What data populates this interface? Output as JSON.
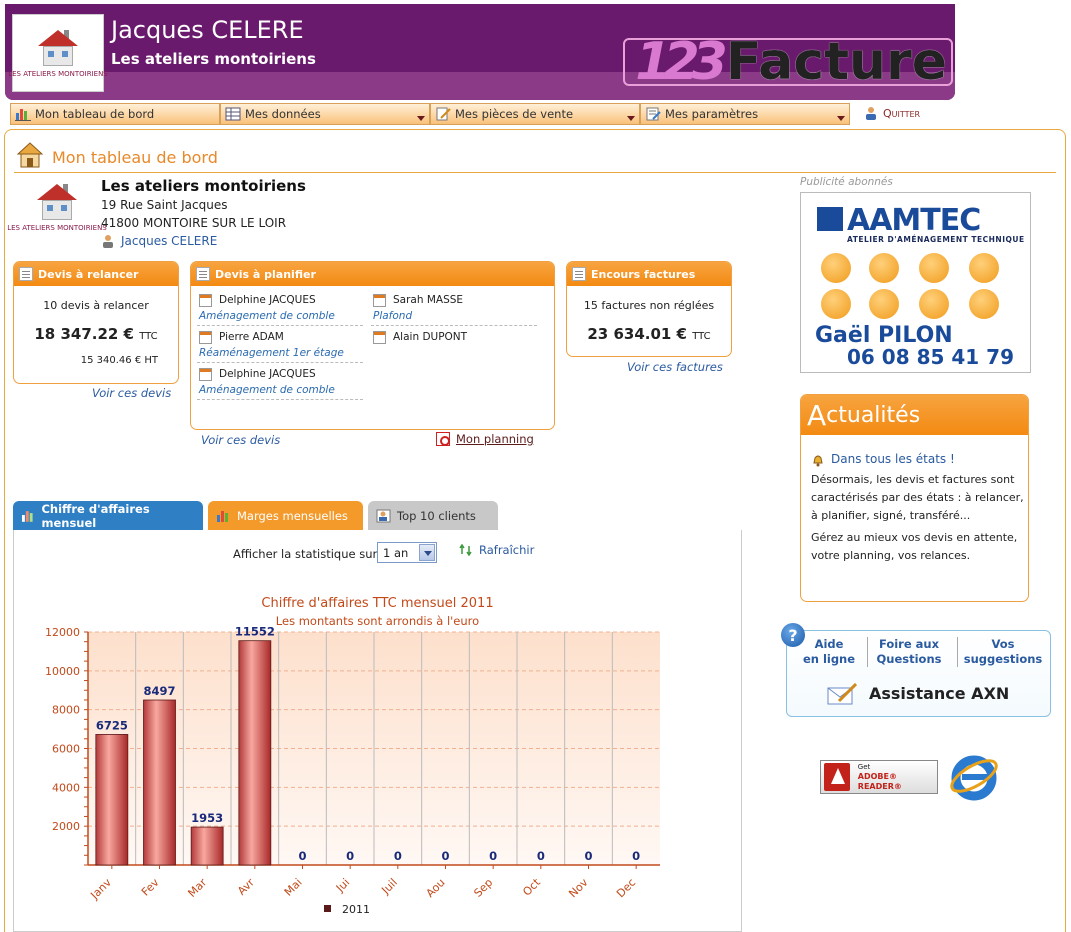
{
  "header": {
    "user_name": "Jacques CELERE",
    "company": "Les ateliers montoiriens",
    "logo_caption": "LES ATELIERS MONTOIRIENS",
    "brand_num": "123",
    "brand_word": "Facture"
  },
  "nav": {
    "items": [
      {
        "label": "Mon tableau de bord",
        "icon": "bar-chart-icon"
      },
      {
        "label": "Mes données",
        "icon": "table-icon"
      },
      {
        "label": "Mes pièces de vente",
        "icon": "document-edit-icon"
      },
      {
        "label": "Mes paramètres",
        "icon": "settings-list-icon"
      }
    ],
    "quit": "Quitter"
  },
  "page": {
    "title": "Mon tableau de bord"
  },
  "company": {
    "name": "Les ateliers montoiriens",
    "address1": "19 Rue Saint Jacques",
    "address2": "41800 MONTOIRE SUR LE LOIR",
    "user": "Jacques CELERE",
    "logo_caption": "LES ATELIERS MONTOIRIENS"
  },
  "devis_relancer": {
    "title": "Devis à relancer",
    "count_text": "10 devis à relancer",
    "amount": "18 347.22 €",
    "amount_unit": "TTC",
    "ht": "15 340.46 € HT",
    "link": "Voir ces devis"
  },
  "devis_planifier": {
    "title": "Devis à planifier",
    "items": [
      {
        "name": "Delphine JACQUES",
        "desc": "Aménagement de comble"
      },
      {
        "name": "Sarah MASSE",
        "desc": "Plafond"
      },
      {
        "name": "Pierre ADAM",
        "desc": "Réaménagement 1er étage"
      },
      {
        "name": "Alain DUPONT",
        "desc": ""
      },
      {
        "name": "Delphine JACQUES",
        "desc": "Aménagement de comble"
      }
    ],
    "link": "Voir ces devis",
    "planning": "Mon planning"
  },
  "encours": {
    "title": "Encours factures",
    "count_text": "15 factures non réglées",
    "amount": "23 634.01 €",
    "amount_unit": "TTC",
    "link": "Voir ces factures"
  },
  "tabs": [
    {
      "label": "Chiffre d'affaires mensuel",
      "color": "#2e7fc4"
    },
    {
      "label": "Marges mensuelles",
      "color": "#f39a2a"
    },
    {
      "label": "Top 10 clients",
      "color": "#bdbdbd"
    }
  ],
  "stat": {
    "label": "Afficher la statistique sur",
    "selected": "1 an",
    "refresh": "Rafraîchir"
  },
  "chart_data": {
    "type": "bar",
    "title": "Chiffre d'affaires TTC mensuel 2011",
    "subtitle": "Les montants sont arrondis à l'euro",
    "categories": [
      "Janv",
      "Fev",
      "Mar",
      "Avr",
      "Mai",
      "Jui",
      "Juil",
      "Aou",
      "Sep",
      "Oct",
      "Nov",
      "Dec"
    ],
    "series": [
      {
        "name": "2011",
        "values": [
          6725,
          8497,
          1953,
          11552,
          0,
          0,
          0,
          0,
          0,
          0,
          0,
          0
        ]
      }
    ],
    "y_ticks": [
      "2000",
      "4000",
      "6000",
      "8000",
      "10000",
      "12000"
    ],
    "ylim": [
      0,
      12000
    ],
    "grid": true,
    "legend": "bottom",
    "bar_color": "#e8706a",
    "label_color": "#1a2a7a"
  },
  "sidebar": {
    "ad_label": "Publicité abonnés",
    "ad_brand": "AAMTEC",
    "ad_tagline": "ATELIER D'AMÉNAGEMENT TECHNIQUE",
    "ad_name": "Gaël PILON",
    "ad_phone": "06 08 85 41 79",
    "news_head_big": "A",
    "news_head_rest": "ctualités",
    "news_title": "Dans tous les états !",
    "news_p1": "Désormais, les devis et factures sont caractérisés par des états : à relancer, à planifier, signé, transféré...",
    "news_p2": "Gérez au mieux vos devis en attente, votre planning, vos relances.",
    "help_col1_a": "Aide",
    "help_col1_b": "en ligne",
    "help_col2_a": "Foire aux",
    "help_col2_b": "Questions",
    "help_col3_a": "Vos",
    "help_col3_b": "suggestions",
    "assistance": "Assistance AXN",
    "adobe_get": "Get",
    "adobe_reader": "ADOBE® READER®"
  }
}
